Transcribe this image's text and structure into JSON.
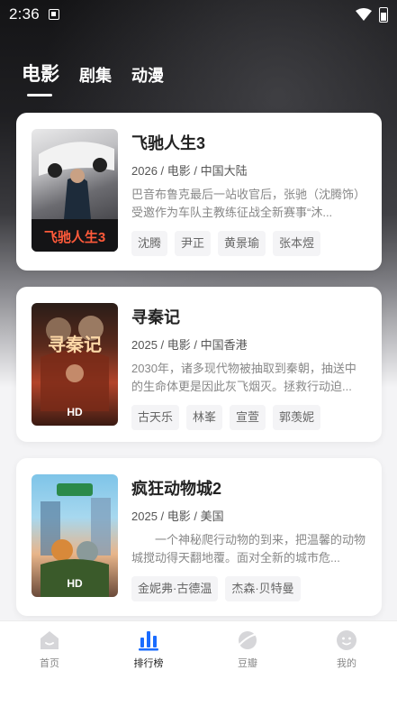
{
  "status_bar": {
    "time": "2:36"
  },
  "tabs": [
    {
      "label": "电影",
      "active": true
    },
    {
      "label": "剧集",
      "active": false
    },
    {
      "label": "动漫",
      "active": false
    }
  ],
  "movies": [
    {
      "title": "飞驰人生3",
      "meta": "2026 / 电影 / 中国大陆",
      "description": "巴音布鲁克最后一站收官后，张驰（沈腾饰）受邀作为车队主教练征战全新赛事“沐...",
      "actors": [
        "沈腾",
        "尹正",
        "黄景瑜",
        "张本煜"
      ],
      "poster_badge": "",
      "poster_text": "飞驰人生3"
    },
    {
      "title": "寻秦记",
      "meta": "2025 / 电影 / 中国香港",
      "description": "2030年，诸多现代物被抽取到秦朝，抽送中的生命体更是因此灰飞烟灭。拯救行动迫...",
      "actors": [
        "古天乐",
        "林峯",
        "宣萱",
        "郭羡妮"
      ],
      "poster_badge": "HD",
      "poster_text": "寻秦记"
    },
    {
      "title": "疯狂动物城2",
      "meta": "2025 / 电影 / 美国",
      "description": "一个神秘爬行动物的到来，把温馨的动物城搅动得天翻地覆。面对全新的城市危...",
      "actors": [
        "金妮弗·古德温",
        "杰森·贝特曼"
      ],
      "poster_badge": "HD",
      "poster_text": ""
    }
  ],
  "bottom_nav": [
    {
      "label": "首页",
      "icon": "home-icon",
      "active": false
    },
    {
      "label": "排行榜",
      "icon": "ranking-icon",
      "active": true
    },
    {
      "label": "豆瓣",
      "icon": "planet-icon",
      "active": false
    },
    {
      "label": "我的",
      "icon": "profile-icon",
      "active": false
    }
  ],
  "colors": {
    "accent": "#1a6cff",
    "inactive_icon": "#d6d6d9"
  }
}
